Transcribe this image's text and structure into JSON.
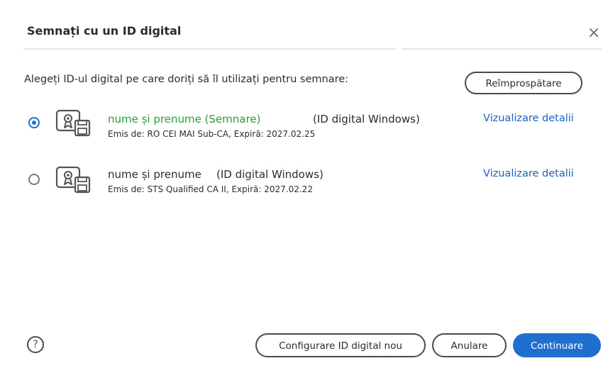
{
  "dialog": {
    "title": "Semnați cu un ID digital",
    "close_icon": "close-icon",
    "instruction": "Alegeți ID-ul digital pe care doriți să îl utilizați pentru semnare:",
    "refresh_label": "Reîmprospătare"
  },
  "ids": [
    {
      "selected": true,
      "name": "nume și prenume (Semnare)",
      "type": "(ID digital Windows)",
      "issuer": "Emis de: RO CEI MAI Sub-CA, Expiră: 2027.02.25",
      "details_label": "Vizualizare detalii",
      "icon": "certificate-icon"
    },
    {
      "selected": false,
      "name": "nume și prenume",
      "type": "(ID digital Windows)",
      "issuer": "Emis de: STS Qualified CA II, Expiră: 2027.02.22",
      "details_label": "Vizualizare detalii",
      "icon": "certificate-icon"
    }
  ],
  "footer": {
    "help_icon": "help-icon",
    "help_glyph": "?",
    "configure_label": "Configurare ID digital nou",
    "cancel_label": "Anulare",
    "continue_label": "Continuare"
  },
  "colors": {
    "accent": "#1f6fd1",
    "selected_name": "#2d9d3c",
    "link": "#1f5fbf"
  }
}
